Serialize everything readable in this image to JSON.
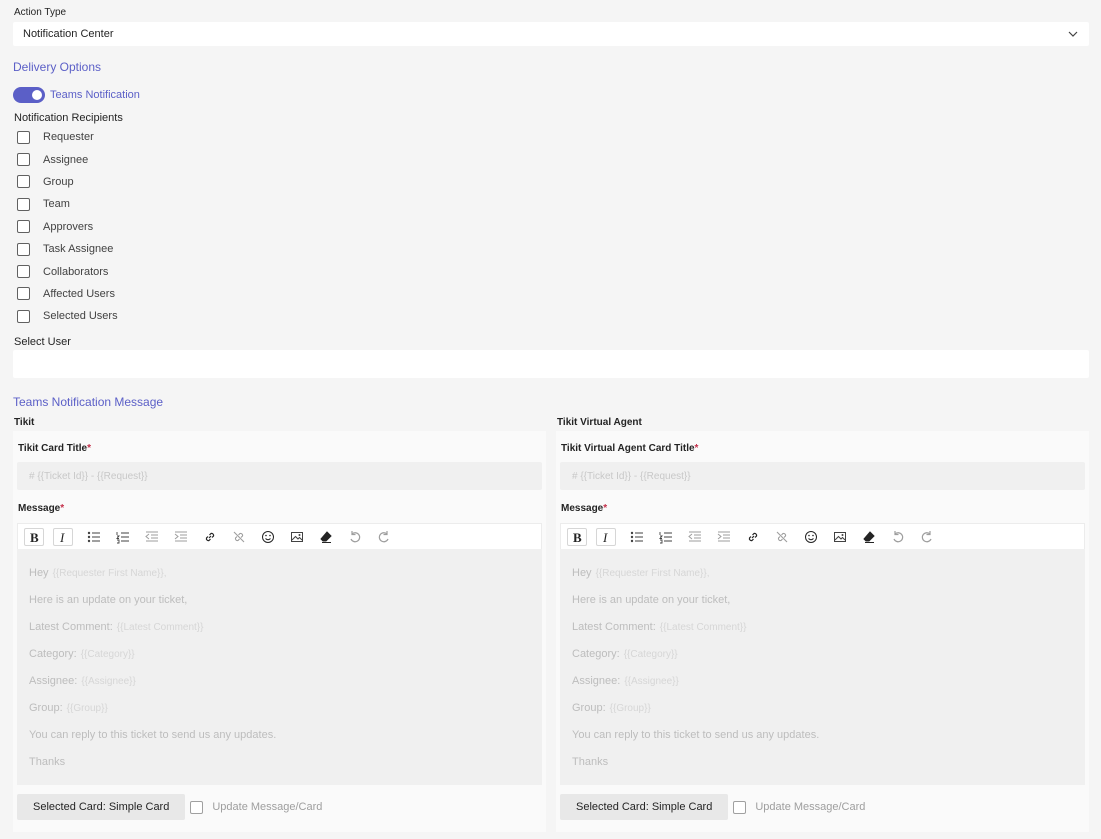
{
  "action_type": {
    "label": "Action Type",
    "value": "Notification Center"
  },
  "delivery_options": {
    "heading": "Delivery Options",
    "toggle_label": "Teams Notification",
    "toggle_on": true
  },
  "recipients": {
    "heading": "Notification Recipients",
    "items": [
      "Requester",
      "Assignee",
      "Group",
      "Team",
      "Approvers",
      "Task Assignee",
      "Collaborators",
      "Affected Users",
      "Selected Users"
    ]
  },
  "select_user": {
    "label": "Select User",
    "value": ""
  },
  "teams_message": {
    "heading": "Teams Notification Message",
    "panels": [
      {
        "heading": "Tikit",
        "title_label": "Tikit Card Title",
        "title_value": "# {{Ticket Id}} - {{Request}}",
        "message_label": "Message",
        "editor_lines": [
          {
            "text": "Hey",
            "placeholder": "{{Requester First Name}},"
          },
          {
            "text": "Here is an update on your ticket,",
            "placeholder": ""
          },
          {
            "text": "Latest Comment:",
            "placeholder": "{{Latest Comment}}"
          },
          {
            "text": "Category:",
            "placeholder": "{{Category}}"
          },
          {
            "text": "Assignee:",
            "placeholder": "{{Assignee}}"
          },
          {
            "text": "Group:",
            "placeholder": "{{Group}}"
          },
          {
            "text": "You can reply to this ticket to send us any updates.",
            "placeholder": ""
          },
          {
            "text": "Thanks",
            "placeholder": ""
          }
        ],
        "card_button": "Selected Card: Simple Card",
        "update_label": "Update Message/Card"
      },
      {
        "heading": "Tikit Virtual Agent",
        "title_label": "Tikit Virtual Agent Card Title",
        "title_value": "# {{Ticket Id}} - {{Request}}",
        "message_label": "Message",
        "editor_lines": [
          {
            "text": "Hey",
            "placeholder": "{{Requester First Name}},"
          },
          {
            "text": "Here is an update on your ticket,",
            "placeholder": ""
          },
          {
            "text": "Latest Comment:",
            "placeholder": "{{Latest Comment}}"
          },
          {
            "text": "Category:",
            "placeholder": "{{Category}}"
          },
          {
            "text": "Assignee:",
            "placeholder": "{{Assignee}}"
          },
          {
            "text": "Group:",
            "placeholder": "{{Group}}"
          },
          {
            "text": "You can reply to this ticket to send us any updates.",
            "placeholder": ""
          },
          {
            "text": "Thanks",
            "placeholder": ""
          }
        ],
        "card_button": "Selected Card: Simple Card",
        "update_label": "Update Message/Card"
      }
    ]
  },
  "toolbar_icons": [
    "bold-icon",
    "italic-icon",
    "bulleted-list-icon",
    "numbered-list-icon",
    "outdent-icon",
    "indent-icon",
    "link-icon",
    "unlink-icon",
    "emoji-icon",
    "image-icon",
    "clear-format-icon",
    "undo-icon",
    "redo-icon"
  ],
  "colors": {
    "accent": "#5b5fc7",
    "required": "#c4314b",
    "page_bg": "#f5f5f5"
  }
}
